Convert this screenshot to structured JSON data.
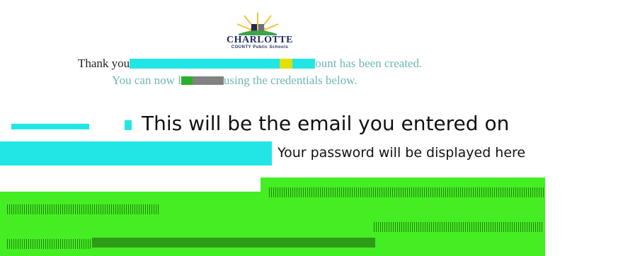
{
  "logo": {
    "brand": "CHARLOTTE",
    "sub_left": "COUNTY",
    "sub_right": "Public Schools",
    "colors": {
      "sun": "#f4c430",
      "navy": "#1c2a5c",
      "green": "#3fa34d"
    }
  },
  "message": {
    "line1_start": "Thank you",
    "line1_end": "ount has been created.",
    "line2_start": "You can now l",
    "line2_end": "using the credentials below."
  },
  "credentials": {
    "email_text": "This will be the email you entered on",
    "password_text": "Your password will be displayed here"
  },
  "colors": {
    "cyan_block": "#22e6e6",
    "green_block": "#44ee22"
  }
}
